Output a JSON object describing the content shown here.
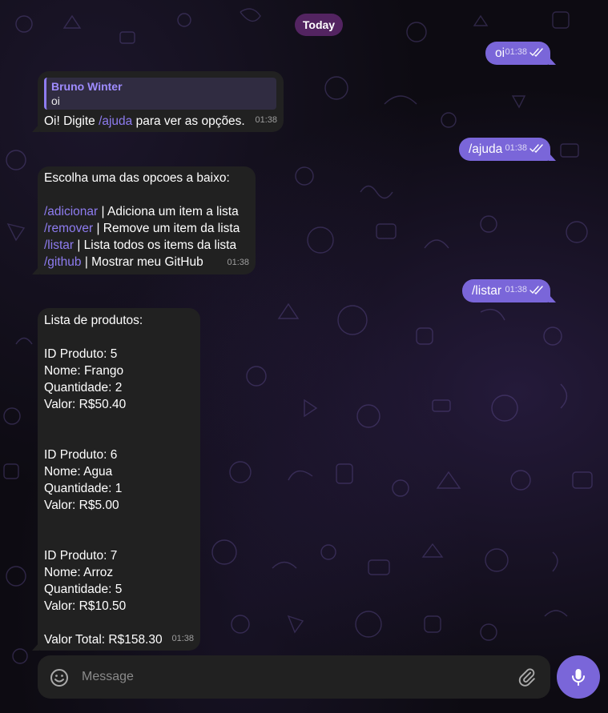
{
  "date_label": "Today",
  "colors": {
    "outgoing_bubble": "#7a66d9",
    "incoming_bubble": "#212121",
    "command_link": "#8e7cf0",
    "date_pill": "#5f286e"
  },
  "messages": [
    {
      "direction": "out",
      "text": "oi",
      "time": "01:38",
      "status": "read-double-check-icon"
    },
    {
      "direction": "in",
      "reply_to": {
        "name": "Bruno Winter",
        "text": "oi"
      },
      "text_before": "Oi! Digite ",
      "command": "/ajuda",
      "text_after": " para ver as opções.",
      "time": "01:38"
    },
    {
      "direction": "out",
      "text": "/ajuda",
      "time": "01:38",
      "status": "read-double-check-icon"
    },
    {
      "direction": "in",
      "header": "Escolha uma das opcoes a baixo:",
      "commands": [
        {
          "command": "/adicionar",
          "desc": " | Adiciona um item a lista"
        },
        {
          "command": "/remover",
          "desc": " | Remove um item da lista"
        },
        {
          "command": "/listar",
          "desc": " | Lista todos os items da lista"
        },
        {
          "command": "/github",
          "desc": " | Mostrar meu GitHub"
        }
      ],
      "time": "01:38"
    },
    {
      "direction": "out",
      "text": "/listar",
      "time": "01:38",
      "status": "read-double-check-icon"
    },
    {
      "direction": "in",
      "header": "Lista de produtos:",
      "products": [
        {
          "id": "ID Produto: 5",
          "name": "Nome: Frango",
          "qty": "Quantidade: 2",
          "value": "Valor: R$50.40"
        },
        {
          "id": "ID Produto: 6",
          "name": "Nome: Agua",
          "qty": "Quantidade: 1",
          "value": "Valor: R$5.00"
        },
        {
          "id": "ID Produto: 7",
          "name": "Nome: Arroz",
          "qty": "Quantidade: 5",
          "value": "Valor: R$10.50"
        }
      ],
      "total": "Valor Total: R$158.30",
      "time": "01:38"
    }
  ],
  "composer": {
    "placeholder": "Message",
    "emoji_icon": "smile-icon",
    "attach_icon": "paperclip-icon",
    "send_icon": "microphone-icon"
  }
}
